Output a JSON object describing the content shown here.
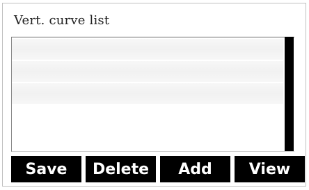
{
  "panel": {
    "title": "Vert. curve list"
  },
  "list": {
    "rows": [
      "",
      "",
      "",
      "",
      ""
    ]
  },
  "buttons": {
    "save_label": "Save",
    "delete_label": "Delete",
    "add_label": "Add",
    "view_label": "View"
  },
  "colors": {
    "button_bg": "#000000",
    "button_text": "#ffffff",
    "scrollbar": "#000000",
    "row_stripe": "#f3f3f3"
  }
}
